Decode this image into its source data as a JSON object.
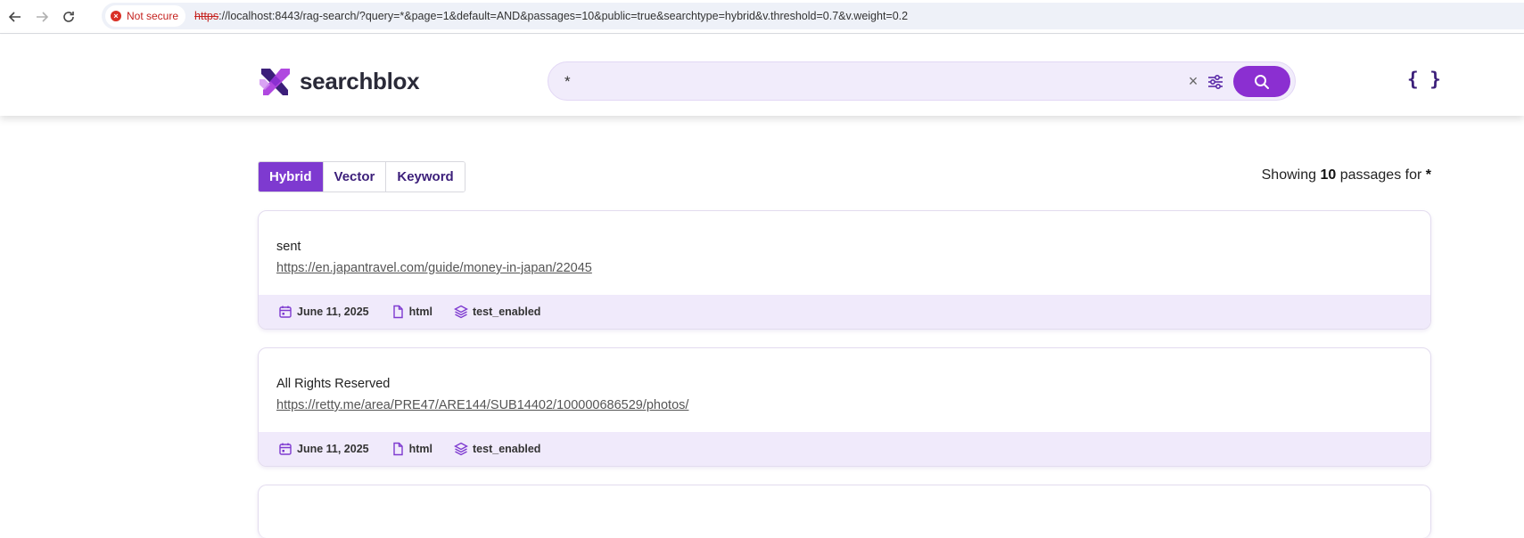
{
  "browser": {
    "security_label": "Not secure",
    "url_scheme": "https",
    "url_rest": "://localhost:8443/rag-search/?query=*&page=1&default=AND&passages=10&public=true&searchtype=hybrid&v.threshold=0.7&v.weight=0.2"
  },
  "header": {
    "logo_text": "searchblox",
    "search_value": "*",
    "clear_label": "×",
    "json_label": "{ }"
  },
  "tabs": [
    {
      "label": "Hybrid",
      "active": true
    },
    {
      "label": "Vector",
      "active": false
    },
    {
      "label": "Keyword",
      "active": false
    }
  ],
  "results_summary": {
    "prefix": "Showing",
    "count": "10",
    "middle": "passages for",
    "query": "*"
  },
  "results": [
    {
      "title": "sent",
      "url": "https://en.japantravel.com/guide/money-in-japan/22045",
      "date": "June 11, 2025",
      "type": "html",
      "collection": "test_enabled"
    },
    {
      "title": "All Rights Reserved",
      "url": "https://retty.me/area/PRE47/ARE144/SUB14402/100000686529/photos/",
      "date": "June 11, 2025",
      "type": "html",
      "collection": "test_enabled"
    }
  ],
  "colors": {
    "brand_purple": "#8b2fd1",
    "tab_active": "#7e3ad0",
    "meta_bg": "#f0eafb",
    "search_bg": "#f1ecfb"
  },
  "icons": [
    "back-arrow-icon",
    "forward-arrow-icon",
    "reload-icon",
    "warning-icon",
    "filter-sliders-icon",
    "search-icon",
    "calendar-icon",
    "document-icon",
    "layers-icon"
  ]
}
